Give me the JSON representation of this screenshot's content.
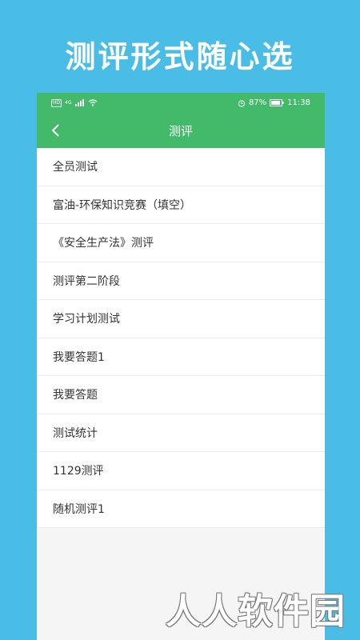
{
  "promo": {
    "title": "测评形式随心选"
  },
  "status_bar": {
    "battery": "87%",
    "time": "11:38",
    "hd": "HD",
    "network": "4G"
  },
  "app_bar": {
    "title": "测评",
    "back_icon": "chevron-left-icon"
  },
  "list": {
    "items": [
      "全员测试",
      "富油-环保知识竞赛（填空）",
      "《安全生产法》测评",
      "测评第二阶段",
      "学习计划测试",
      "我要答题1",
      "我要答题",
      "测试统计",
      "1129测评",
      "随机测评1"
    ]
  },
  "watermark": {
    "text": "人人软件园"
  },
  "colors": {
    "background": "#49bde6",
    "header": "#43b96a",
    "list_bg": "#ffffff"
  }
}
